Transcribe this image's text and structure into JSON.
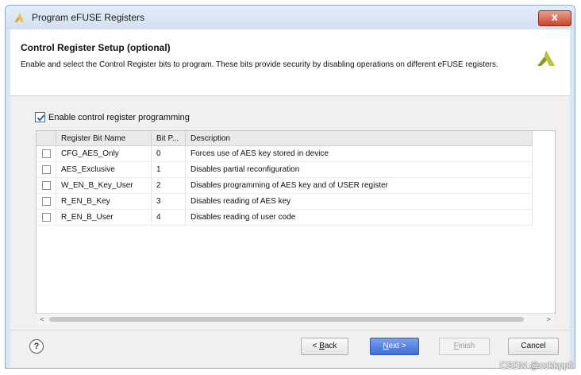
{
  "window": {
    "title": "Program eFUSE Registers",
    "close_symbol": "x"
  },
  "header": {
    "title": "Control Register Setup (optional)",
    "description": "Enable and select the Control Register bits to program. These bits provide security by disabling operations on different eFUSE registers."
  },
  "enable": {
    "label": "Enable control register programming",
    "checked": true
  },
  "table": {
    "columns": [
      "",
      "Register Bit Name",
      "Bit P...",
      "Description"
    ],
    "rows": [
      {
        "name": "CFG_AES_Only",
        "bit": "0",
        "description": "Forces use of AES key stored in device"
      },
      {
        "name": "AES_Exclusive",
        "bit": "1",
        "description": "Disables partial reconfiguration"
      },
      {
        "name": "W_EN_B_Key_User",
        "bit": "2",
        "description": "Disables programming of AES key and of USER register"
      },
      {
        "name": "R_EN_B_Key",
        "bit": "3",
        "description": "Disables reading of AES key"
      },
      {
        "name": "R_EN_B_User",
        "bit": "4",
        "description": "Disables reading of user code"
      }
    ]
  },
  "scrollbar": {
    "left_arrow": "<",
    "right_arrow": ">"
  },
  "buttons": {
    "help": "?",
    "back_prefix": "< ",
    "back_mnemonic": "B",
    "back_rest": "ack",
    "next_mnemonic": "N",
    "next_rest": "ext >",
    "finish_mnemonic": "F",
    "finish_rest": "inish",
    "cancel": "Cancel"
  },
  "watermark": "CSDN @cckkppll",
  "colors": {
    "accent": "#3e6ed6",
    "close": "#c8442a",
    "logo": "#9aa72a"
  }
}
